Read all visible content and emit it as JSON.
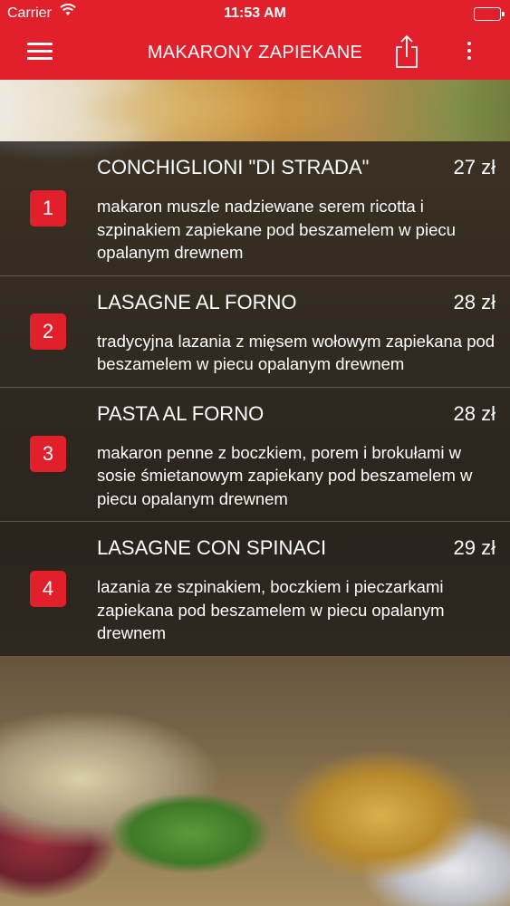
{
  "status_bar": {
    "carrier": "Carrier",
    "time": "11:53 AM"
  },
  "nav": {
    "title": "MAKARONY ZAPIEKANE"
  },
  "colors": {
    "accent": "#e2202c"
  },
  "icons": {
    "menu": "hamburger-icon",
    "share": "share-icon",
    "more": "more-vertical-icon",
    "wifi": "wifi-icon",
    "battery": "battery-icon"
  },
  "items": [
    {
      "number": "1",
      "name": "CONCHIGLIONI \"DI STRADA\"",
      "price": "27 zł",
      "description": "makaron muszle nadziewane serem ricotta i szpinakiem zapiekane pod beszamelem w piecu opalanym drewnem"
    },
    {
      "number": "2",
      "name": "LASAGNE AL FORNO",
      "price": "28 zł",
      "description": "tradycyjna lazania z mięsem wołowym zapiekana pod beszamelem w piecu opalanym drewnem"
    },
    {
      "number": "3",
      "name": "PASTA AL FORNO",
      "price": "28 zł",
      "description": "makaron penne z boczkiem, porem i brokułami w sosie śmietanowym zapiekany pod beszamelem w piecu opalanym drewnem"
    },
    {
      "number": "4",
      "name": "LASAGNE CON SPINACI",
      "price": "29 zł",
      "description": "lazania ze szpinakiem, boczkiem i pieczarkami zapiekana pod beszamelem w piecu opalanym drewnem"
    }
  ]
}
